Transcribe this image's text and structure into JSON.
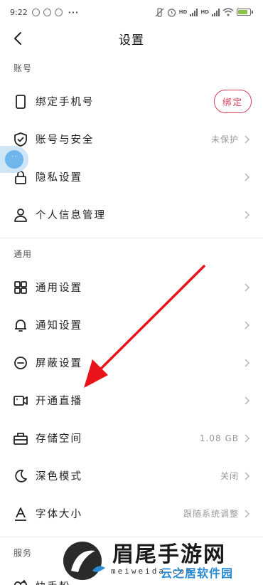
{
  "status_bar": {
    "time": "9:22",
    "dots": "···",
    "hd1": "HD",
    "hd2": "HD",
    "battery_percent": 80
  },
  "header": {
    "title": "设置"
  },
  "sections": [
    {
      "title": "账号",
      "items": [
        {
          "label": "绑定手机号",
          "button": "绑定",
          "icon": "phone-icon"
        },
        {
          "label": "账号与安全",
          "status": "未保护",
          "icon": "shield-check-icon"
        },
        {
          "label": "隐私设置",
          "icon": "lock-icon"
        },
        {
          "label": "个人信息管理",
          "icon": "person-icon"
        }
      ]
    },
    {
      "title": "通用",
      "items": [
        {
          "label": "通用设置",
          "icon": "grid-icon"
        },
        {
          "label": "通知设置",
          "icon": "bell-icon"
        },
        {
          "label": "屏蔽设置",
          "icon": "block-icon"
        },
        {
          "label": "开通直播",
          "icon": "video-camera-icon"
        },
        {
          "label": "存储空间",
          "status": "1.08 GB",
          "icon": "storage-icon"
        },
        {
          "label": "深色模式",
          "status": "关闭",
          "icon": "moon-icon"
        },
        {
          "label": "字体大小",
          "status": "跟随系统调整",
          "icon": "font-size-icon"
        }
      ]
    },
    {
      "title": "服务",
      "items": [
        {
          "label": "快手粉",
          "icon": "fan-icon"
        }
      ]
    }
  ],
  "watermark": {
    "brand": "眉尾手游网",
    "site": "meiweida.com",
    "sub": "云之居软件园"
  },
  "colors": {
    "accent": "#d9415b",
    "arrow": "#e8131b",
    "float_ball": "#6fb6ec"
  }
}
